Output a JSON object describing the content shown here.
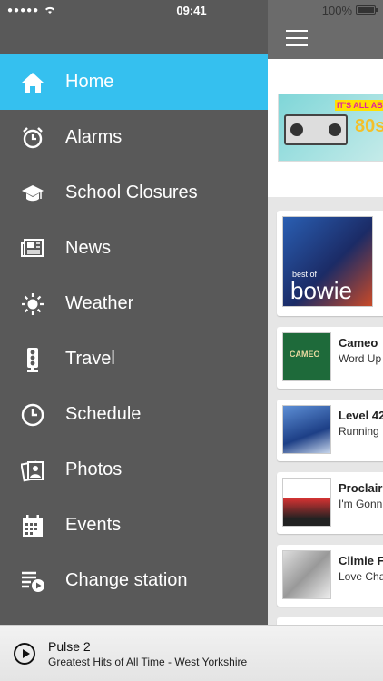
{
  "status": {
    "time": "09:41",
    "battery": "100%"
  },
  "menu": [
    {
      "label": "Home",
      "icon": "home-icon",
      "active": true
    },
    {
      "label": "Alarms",
      "icon": "alarm-clock-icon"
    },
    {
      "label": "School Closures",
      "icon": "graduation-cap-icon"
    },
    {
      "label": "News",
      "icon": "newspaper-icon"
    },
    {
      "label": "Weather",
      "icon": "sun-icon"
    },
    {
      "label": "Travel",
      "icon": "traffic-light-icon"
    },
    {
      "label": "Schedule",
      "icon": "clock-icon"
    },
    {
      "label": "Photos",
      "icon": "photos-icon"
    },
    {
      "label": "Events",
      "icon": "calendar-icon"
    },
    {
      "label": "Change station",
      "icon": "playlist-icon"
    }
  ],
  "banner": {
    "title": "IT'S ALL ABOUT T",
    "big": "80s"
  },
  "tracks": [
    {
      "title": "",
      "subtitle": "",
      "art_text": "bowie",
      "art_sub": "best of"
    },
    {
      "title": "Cameo",
      "subtitle": "Word Up",
      "art_text": "CAMEO"
    },
    {
      "title": "Level 42",
      "subtitle": "Running"
    },
    {
      "title": "Proclair",
      "subtitle": "I'm Gonn"
    },
    {
      "title": "Climie F",
      "subtitle": "Love Cha"
    }
  ],
  "player": {
    "station": "Pulse 2",
    "now_playing": "Greatest Hits of All Time - West Yorkshire"
  },
  "colors": {
    "accent": "#35c0ef",
    "sidebar": "#595959"
  }
}
